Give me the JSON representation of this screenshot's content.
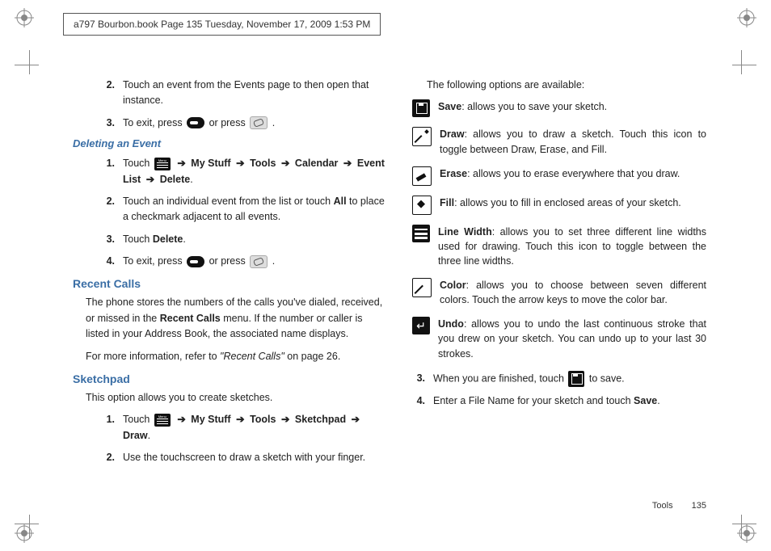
{
  "header": "a797 Bourbon.book  Page 135  Tuesday, November 17, 2009  1:53 PM",
  "left": {
    "step2": "Touch an event from the Events page to then open that instance.",
    "step3_a": "To exit, press ",
    "step3_b": " or press ",
    "step3_c": ".",
    "delete_heading": "Deleting an Event",
    "del1_a": "Touch ",
    "del1_b": "My Stuff",
    "del1_c": "Tools",
    "del1_d": "Calendar",
    "del1_e": "Event List",
    "del1_f": "Delete",
    "del2_a": "Touch an individual event from the list or touch ",
    "del2_all": "All",
    "del2_b": " to place a checkmark adjacent to all events.",
    "del3_a": "Touch ",
    "del3_b": "Delete",
    "del3_c": ".",
    "del4_a": "To exit, press ",
    "del4_b": " or press ",
    "del4_c": ".",
    "recent_heading": "Recent Calls",
    "recent_p1_a": "The phone stores the numbers of the calls you've dialed, received, or missed in the ",
    "recent_p1_b": "Recent Calls",
    "recent_p1_c": " menu. If the number or caller is listed in your Address Book, the associated name displays.",
    "recent_p2_a": "For more information, refer to ",
    "recent_p2_b": "\"Recent Calls\"",
    "recent_p2_c": "  on page 26.",
    "sketch_heading": "Sketchpad",
    "sketch_intro": "This option allows you to create sketches.",
    "sk1_a": "Touch ",
    "sk1_b": "My Stuff",
    "sk1_c": "Tools",
    "sk1_d": "Sketchpad",
    "sk1_e": "Draw",
    "sk2": "Use the touchscreen to draw a sketch with your finger."
  },
  "right": {
    "intro": "The following options are available:",
    "save_l": "Save",
    "save_t": ": allows you to save your sketch.",
    "draw_l": "Draw",
    "draw_t": ": allows you to draw a sketch. Touch this icon to toggle between Draw, Erase, and Fill.",
    "erase_l": "Erase",
    "erase_t": ": allows you to erase everywhere that you draw.",
    "fill_l": "Fill",
    "fill_t": ": allows you to fill in enclosed areas of your sketch.",
    "line_l": "Line Width",
    "line_t": ": allows you to set three different line widths used for drawing. Touch this icon to toggle between the three line widths.",
    "color_l": "Color",
    "color_t": ": allows you to choose between seven different colors. Touch the arrow keys to move the color bar.",
    "undo_l": "Undo",
    "undo_t": ": allows you to undo the last continuous stroke that you drew on your sketch. You can undo up to your last 30 strokes.",
    "step3_a": "When you are finished, touch ",
    "step3_b": " to save.",
    "step4_a": "Enter a File Name for your sketch and touch ",
    "step4_b": "Save",
    "step4_c": "."
  },
  "footer": {
    "section": "Tools",
    "page": "135"
  },
  "nums": {
    "n1": "1.",
    "n2": "2.",
    "n3": "3.",
    "n4": "4."
  },
  "arrow": "➔"
}
